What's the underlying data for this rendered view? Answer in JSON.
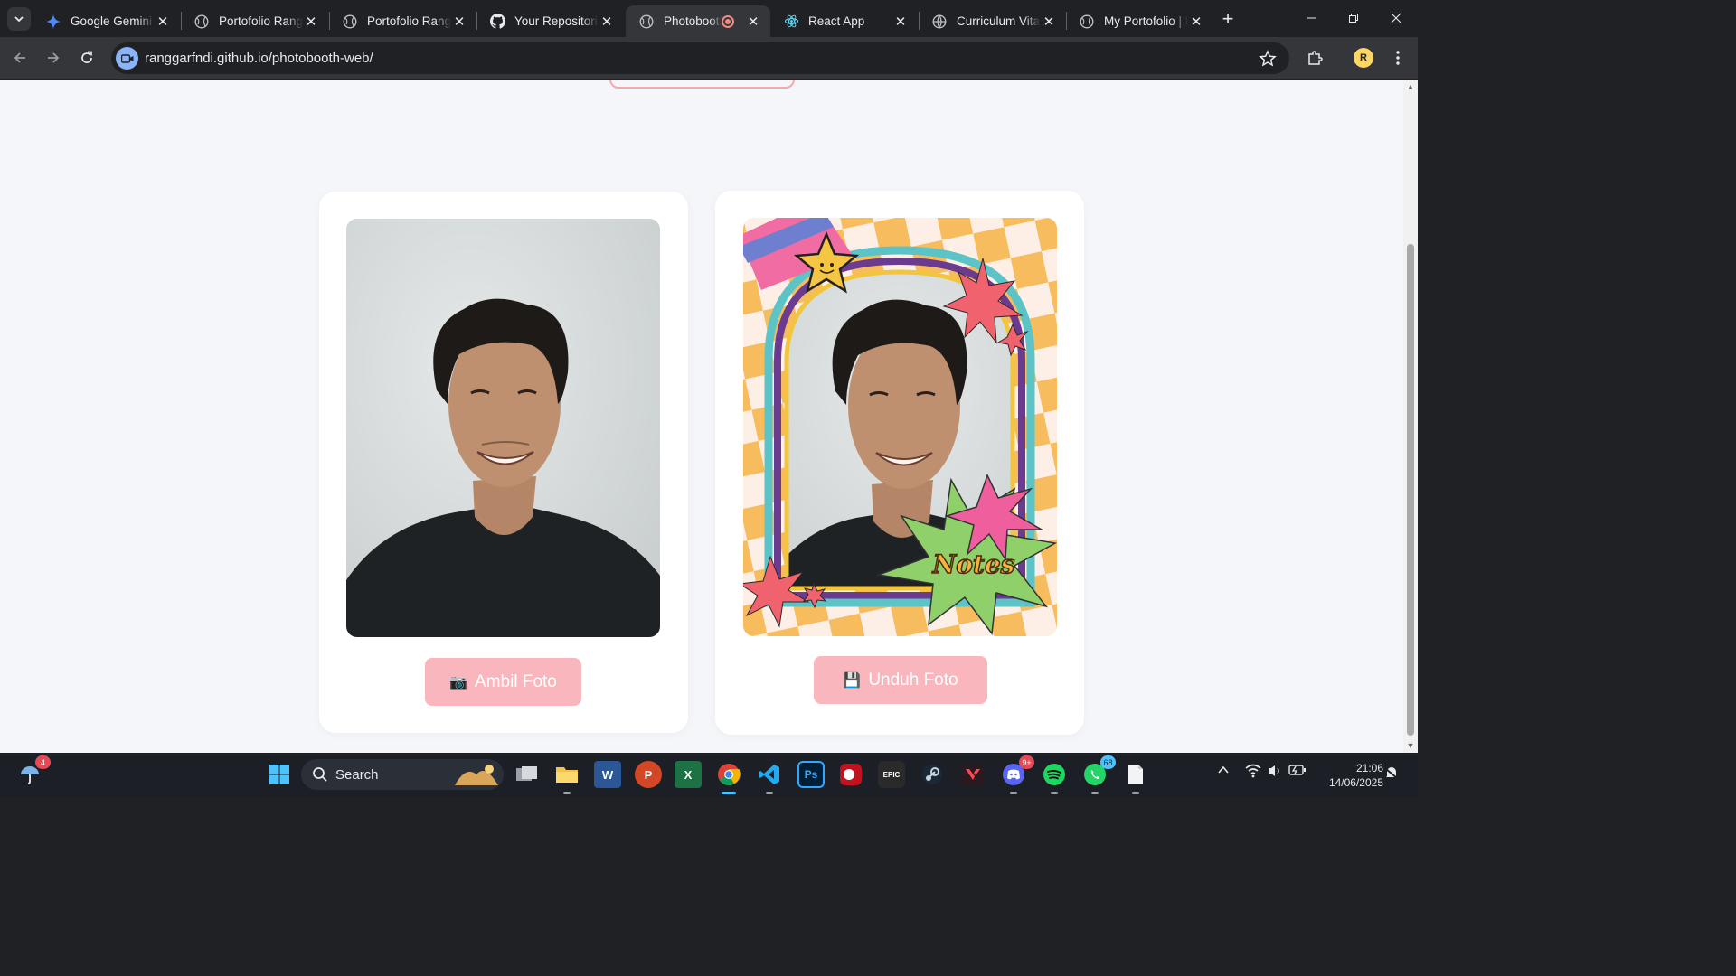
{
  "browser": {
    "tabs": [
      {
        "title": "Google Gemini",
        "icon": "gemini-icon"
      },
      {
        "title": "Portofolio Rangga",
        "icon": "globe-icon"
      },
      {
        "title": "Portofolio Rangga",
        "icon": "globe-icon"
      },
      {
        "title": "Your Repositories",
        "icon": "github-icon"
      },
      {
        "title": "Photobooth",
        "icon": "globe-icon",
        "active": true,
        "recording": true
      },
      {
        "title": "React App",
        "icon": "react-icon"
      },
      {
        "title": "Curriculum Vitae",
        "icon": "globe-icon"
      },
      {
        "title": "My Portofolio | R",
        "icon": "globe-icon"
      }
    ],
    "url": "ranggarfndi.github.io/photobooth-web/",
    "profile_initial": "R"
  },
  "page": {
    "camera_card": {
      "button_label": "Ambil Foto",
      "button_icon": "📷"
    },
    "result_card": {
      "frame_text": "Notes",
      "button_label": "Unduh Foto",
      "button_icon": "💾"
    }
  },
  "taskbar": {
    "search_label": "Search",
    "weather_badge": "4",
    "discord_badge": "9+",
    "whatsapp_badge": "68",
    "time": "21:06",
    "date": "14/06/2025"
  },
  "colors": {
    "button_pink": "#f9b7bd",
    "page_bg": "#f5f6fa",
    "frame_orange": "#f6bc5e",
    "frame_cream": "#fdefe6"
  }
}
